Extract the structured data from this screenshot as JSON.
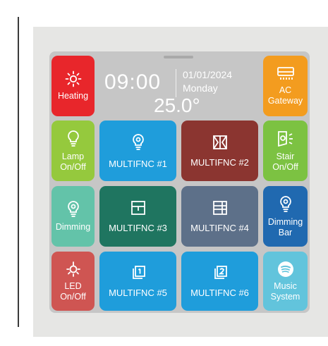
{
  "status": {
    "time": "09:00",
    "date": "01/01/2024",
    "weekday": "Monday",
    "temperature": "25.0°"
  },
  "tiles": {
    "heating": {
      "label": "Heating",
      "icon": "sun-icon",
      "color": "#e8262b"
    },
    "ac_gateway": {
      "label": "AC\nGateway",
      "icon": "air-conditioner-icon",
      "color": "#f39c1f"
    },
    "lamp": {
      "label": "Lamp\nOn/Off",
      "icon": "bulb-icon",
      "color": "#95c93d"
    },
    "multifnc1": {
      "label": "MULTIFNC #1",
      "icon": "bulb-icon",
      "color": "#1f9ddb"
    },
    "multifnc2": {
      "label": "MULTIFNC #2",
      "icon": "window-icon",
      "color": "#8b3530"
    },
    "stair": {
      "label": "Stair\nOn/Off",
      "icon": "stair-light-icon",
      "color": "#7cc242"
    },
    "dimming": {
      "label": "Dimming",
      "icon": "bulb-icon",
      "color": "#63c3a9"
    },
    "multifnc3": {
      "label": "MULTIFNC #3",
      "icon": "shutter-icon",
      "color": "#1f7560"
    },
    "multifnc4": {
      "label": "MULTIFNC #4",
      "icon": "blind-icon",
      "color": "#5d7089"
    },
    "dimming_bar": {
      "label": "Dimming\nBar",
      "icon": "bulb-icon",
      "color": "#2069b0"
    },
    "led": {
      "label": "LED\nOn/Off",
      "icon": "led-icon",
      "color": "#cf5552"
    },
    "multifnc5": {
      "label": "MULTIFNC #5",
      "icon": "pages-one-icon",
      "color": "#1f9ddb"
    },
    "multifnc6": {
      "label": "MULTIFNC #6",
      "icon": "pages-two-icon",
      "color": "#1f9ddb"
    },
    "music": {
      "label": "Music\nSystem",
      "icon": "spotify-icon",
      "color": "#62c4dc"
    }
  }
}
